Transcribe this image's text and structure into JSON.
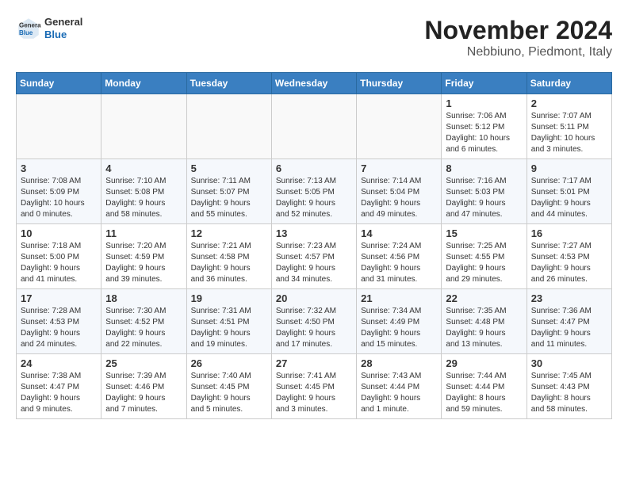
{
  "logo": {
    "general": "General",
    "blue": "Blue"
  },
  "title": "November 2024",
  "location": "Nebbiuno, Piedmont, Italy",
  "days_header": [
    "Sunday",
    "Monday",
    "Tuesday",
    "Wednesday",
    "Thursday",
    "Friday",
    "Saturday"
  ],
  "weeks": [
    [
      {
        "day": "",
        "info": ""
      },
      {
        "day": "",
        "info": ""
      },
      {
        "day": "",
        "info": ""
      },
      {
        "day": "",
        "info": ""
      },
      {
        "day": "",
        "info": ""
      },
      {
        "day": "1",
        "info": "Sunrise: 7:06 AM\nSunset: 5:12 PM\nDaylight: 10 hours\nand 6 minutes."
      },
      {
        "day": "2",
        "info": "Sunrise: 7:07 AM\nSunset: 5:11 PM\nDaylight: 10 hours\nand 3 minutes."
      }
    ],
    [
      {
        "day": "3",
        "info": "Sunrise: 7:08 AM\nSunset: 5:09 PM\nDaylight: 10 hours\nand 0 minutes."
      },
      {
        "day": "4",
        "info": "Sunrise: 7:10 AM\nSunset: 5:08 PM\nDaylight: 9 hours\nand 58 minutes."
      },
      {
        "day": "5",
        "info": "Sunrise: 7:11 AM\nSunset: 5:07 PM\nDaylight: 9 hours\nand 55 minutes."
      },
      {
        "day": "6",
        "info": "Sunrise: 7:13 AM\nSunset: 5:05 PM\nDaylight: 9 hours\nand 52 minutes."
      },
      {
        "day": "7",
        "info": "Sunrise: 7:14 AM\nSunset: 5:04 PM\nDaylight: 9 hours\nand 49 minutes."
      },
      {
        "day": "8",
        "info": "Sunrise: 7:16 AM\nSunset: 5:03 PM\nDaylight: 9 hours\nand 47 minutes."
      },
      {
        "day": "9",
        "info": "Sunrise: 7:17 AM\nSunset: 5:01 PM\nDaylight: 9 hours\nand 44 minutes."
      }
    ],
    [
      {
        "day": "10",
        "info": "Sunrise: 7:18 AM\nSunset: 5:00 PM\nDaylight: 9 hours\nand 41 minutes."
      },
      {
        "day": "11",
        "info": "Sunrise: 7:20 AM\nSunset: 4:59 PM\nDaylight: 9 hours\nand 39 minutes."
      },
      {
        "day": "12",
        "info": "Sunrise: 7:21 AM\nSunset: 4:58 PM\nDaylight: 9 hours\nand 36 minutes."
      },
      {
        "day": "13",
        "info": "Sunrise: 7:23 AM\nSunset: 4:57 PM\nDaylight: 9 hours\nand 34 minutes."
      },
      {
        "day": "14",
        "info": "Sunrise: 7:24 AM\nSunset: 4:56 PM\nDaylight: 9 hours\nand 31 minutes."
      },
      {
        "day": "15",
        "info": "Sunrise: 7:25 AM\nSunset: 4:55 PM\nDaylight: 9 hours\nand 29 minutes."
      },
      {
        "day": "16",
        "info": "Sunrise: 7:27 AM\nSunset: 4:53 PM\nDaylight: 9 hours\nand 26 minutes."
      }
    ],
    [
      {
        "day": "17",
        "info": "Sunrise: 7:28 AM\nSunset: 4:53 PM\nDaylight: 9 hours\nand 24 minutes."
      },
      {
        "day": "18",
        "info": "Sunrise: 7:30 AM\nSunset: 4:52 PM\nDaylight: 9 hours\nand 22 minutes."
      },
      {
        "day": "19",
        "info": "Sunrise: 7:31 AM\nSunset: 4:51 PM\nDaylight: 9 hours\nand 19 minutes."
      },
      {
        "day": "20",
        "info": "Sunrise: 7:32 AM\nSunset: 4:50 PM\nDaylight: 9 hours\nand 17 minutes."
      },
      {
        "day": "21",
        "info": "Sunrise: 7:34 AM\nSunset: 4:49 PM\nDaylight: 9 hours\nand 15 minutes."
      },
      {
        "day": "22",
        "info": "Sunrise: 7:35 AM\nSunset: 4:48 PM\nDaylight: 9 hours\nand 13 minutes."
      },
      {
        "day": "23",
        "info": "Sunrise: 7:36 AM\nSunset: 4:47 PM\nDaylight: 9 hours\nand 11 minutes."
      }
    ],
    [
      {
        "day": "24",
        "info": "Sunrise: 7:38 AM\nSunset: 4:47 PM\nDaylight: 9 hours\nand 9 minutes."
      },
      {
        "day": "25",
        "info": "Sunrise: 7:39 AM\nSunset: 4:46 PM\nDaylight: 9 hours\nand 7 minutes."
      },
      {
        "day": "26",
        "info": "Sunrise: 7:40 AM\nSunset: 4:45 PM\nDaylight: 9 hours\nand 5 minutes."
      },
      {
        "day": "27",
        "info": "Sunrise: 7:41 AM\nSunset: 4:45 PM\nDaylight: 9 hours\nand 3 minutes."
      },
      {
        "day": "28",
        "info": "Sunrise: 7:43 AM\nSunset: 4:44 PM\nDaylight: 9 hours\nand 1 minute."
      },
      {
        "day": "29",
        "info": "Sunrise: 7:44 AM\nSunset: 4:44 PM\nDaylight: 8 hours\nand 59 minutes."
      },
      {
        "day": "30",
        "info": "Sunrise: 7:45 AM\nSunset: 4:43 PM\nDaylight: 8 hours\nand 58 minutes."
      }
    ]
  ]
}
